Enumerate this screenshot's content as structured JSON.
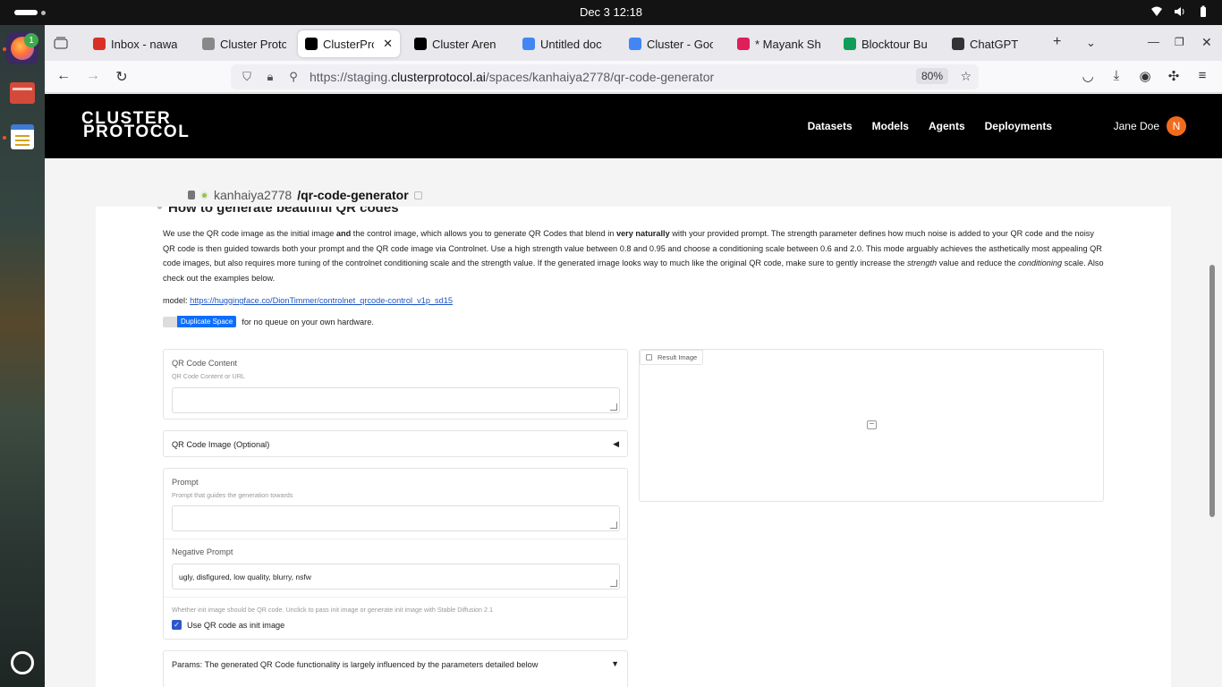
{
  "system": {
    "clock": "Dec 3  12:18",
    "dock_badge": "1"
  },
  "browser": {
    "tabs": [
      {
        "title": "Inbox - nawa",
        "favicon": "gmail-icon",
        "color": "#d93025"
      },
      {
        "title": "Cluster Proto",
        "favicon": "cluster-icon",
        "color": "#888888"
      },
      {
        "title": "ClusterPro",
        "favicon": "cluster-logo-icon",
        "color": "#000000",
        "active": true
      },
      {
        "title": "Cluster Aren",
        "favicon": "cluster-logo-icon",
        "color": "#000000"
      },
      {
        "title": "Untitled doc",
        "favicon": "docs-icon",
        "color": "#4285f4"
      },
      {
        "title": "Cluster - Goo",
        "favicon": "docs-icon",
        "color": "#4285f4"
      },
      {
        "title": "* Mayank Sha",
        "favicon": "slack-icon",
        "color": "#e01e5a"
      },
      {
        "title": "Blocktour Bu",
        "favicon": "sheets-icon",
        "color": "#0f9d58"
      },
      {
        "title": "ChatGPT",
        "favicon": "chatgpt-icon",
        "color": "#333333"
      }
    ],
    "url_prefix": "https://staging.",
    "url_domain": "clusterprotocol.ai",
    "url_path": "/spaces/kanhaiya2778/qr-code-generator",
    "zoom": "80%"
  },
  "site": {
    "logo_line1": "CLUSTER",
    "logo_line2": "PROTOCOL",
    "nav": [
      "Datasets",
      "Models",
      "Agents",
      "Deployments"
    ],
    "user_name": "Jane Doe",
    "user_initial": "N",
    "crumb_owner": "kanhaiya2778",
    "crumb_repo": "/qr-code-generator"
  },
  "app": {
    "heading": "How to generate beautiful QR codes",
    "desc_1": "We use the QR code image as the initial image ",
    "desc_and": "and",
    "desc_2": " the control image, which allows you to generate QR Codes that blend in ",
    "desc_naturally": "very naturally",
    "desc_3": " with your provided prompt. The strength parameter defines how much noise is added to your QR code and the noisy QR code is then guided towards both your prompt and the QR code image via Controlnet. Use a high strength value between 0.8 and 0.95 and choose a conditioning scale between 0.6 and 2.0. This mode arguably achieves the asthetically most appealing QR code images, but also requires more tuning of the controlnet conditioning scale and the strength value. If the generated image looks way to much like the original QR code, make sure to gently increase the ",
    "desc_strength": "strength",
    "desc_4": " value and reduce the ",
    "desc_conditioning": "conditioning",
    "desc_5": " scale. Also check out the examples below.",
    "model_label": "model: ",
    "model_link": "https://huggingface.co/DionTimmer/controlnet_qrcode-control_v1p_sd15",
    "duplicate_button": "Duplicate Space",
    "duplicate_text": "for no queue on your own hardware.",
    "qr_content_label": "QR Code Content",
    "qr_content_info": "QR Code Content or URL",
    "qr_content_value": "",
    "qr_image_label": "QR Code Image (Optional)",
    "prompt_label": "Prompt",
    "prompt_info": "Prompt that guides the generation towards",
    "prompt_value": "",
    "neg_label": "Negative Prompt",
    "neg_value": "ugly, disfigured, low quality, blurry, nsfw",
    "init_info": "Whether init image should be QR code. Unclick to pass init image or generate init image with Stable Diffusion 2.1",
    "init_check_label": "Use QR code as init image",
    "init_checked": true,
    "params_label": "Params: The generated QR Code functionality is largely influenced by the parameters detailed below",
    "result_label": "Result Image",
    "arrow_collapsed": "◀",
    "arrow_expanded": "▼",
    "check_mark": "✓"
  }
}
